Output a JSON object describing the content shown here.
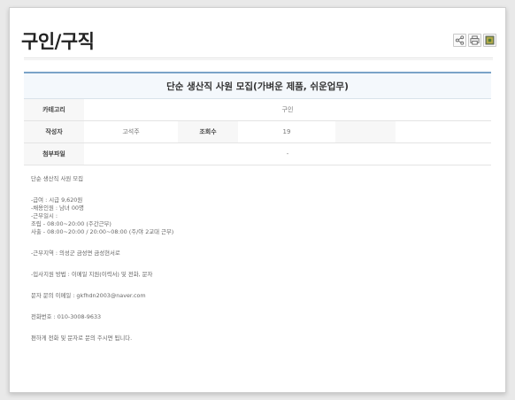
{
  "page_title": "구인/구직",
  "toolbar": {
    "share_icon": "share-icon",
    "print_icon": "print-icon",
    "image_icon": "image-icon"
  },
  "post": {
    "title": "단순 생산직 사원 모집(가벼운 제품, 쉬운업무)",
    "category_label": "카테고리",
    "category_value": "구인",
    "author_label": "작성자",
    "author_value": "고석주",
    "views_label": "조회수",
    "views_value": "19",
    "attachment_label": "첨부파일",
    "attachment_value": "-"
  },
  "body": {
    "line1": "단순 생산직 사원 모집",
    "line2": " -급여 : 시급 9,620원",
    "line3": "-채용인원 : 남녀 00명",
    "line4": "-근무일시 :",
    "line5": " 조립 - 08:00~20:00 (주간근무)",
    "line6": " 사출 - 08:00~20:00 / 20:00~08:00 (주/야 2교대 근무)",
    "line7": "-근무지역 : 의성군 금성면 금성현서로",
    "line8": "-입사지원 방법 : 이메일 지원(이력서) 및 전화, 문자",
    "line9": "문자 문의 이메일 : gkfhdn2003@naver.com",
    "line10": "전화번호 : 010-3008-9633",
    "line11": "편하게 전화 및 문자로 문의 주시면 됩니다."
  },
  "colors": {
    "accent_border": "#7aa3c8",
    "header_bg": "#f4f8fc"
  }
}
